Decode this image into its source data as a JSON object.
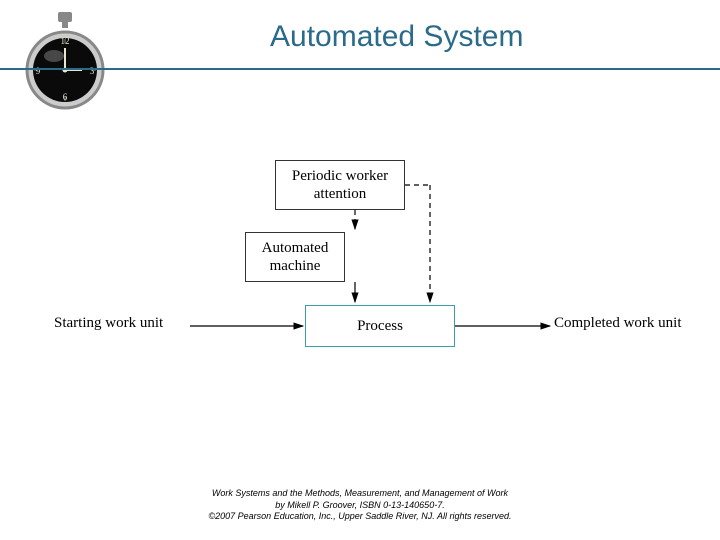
{
  "header": {
    "title": "Automated System"
  },
  "diagram": {
    "periodic_box": "Periodic worker\nattention",
    "automated_box": "Automated\nmachine",
    "process_box": "Process",
    "start_label": "Starting work unit",
    "end_label": "Completed work unit"
  },
  "footer": {
    "line1": "Work Systems and the Methods, Measurement, and Management of Work",
    "line2": "by Mikell P. Groover, ISBN 0-13-140650-7.",
    "line3": "©2007 Pearson Education, Inc., Upper Saddle River, NJ.  All rights reserved."
  },
  "chart_data": {
    "type": "diagram",
    "title": "Automated System",
    "nodes": [
      {
        "id": "start",
        "label": "Starting work unit",
        "kind": "text"
      },
      {
        "id": "periodic",
        "label": "Periodic worker attention",
        "kind": "box"
      },
      {
        "id": "automated",
        "label": "Automated machine",
        "kind": "box"
      },
      {
        "id": "process",
        "label": "Process",
        "kind": "box-highlight"
      },
      {
        "id": "end",
        "label": "Completed work unit",
        "kind": "text"
      }
    ],
    "edges": [
      {
        "from": "start",
        "to": "process",
        "style": "solid"
      },
      {
        "from": "automated",
        "to": "process",
        "style": "solid"
      },
      {
        "from": "periodic",
        "to": "process",
        "style": "dashed"
      },
      {
        "from": "periodic",
        "to": "automated",
        "style": "dashed"
      },
      {
        "from": "process",
        "to": "end",
        "style": "solid"
      }
    ]
  }
}
